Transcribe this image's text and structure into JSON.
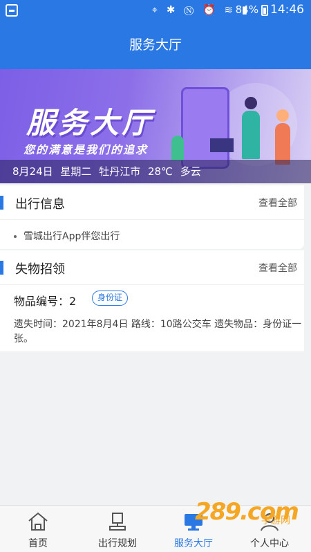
{
  "status_bar": {
    "icons": [
      "location-icon",
      "bluetooth-icon",
      "nfc-icon",
      "alarm-icon",
      "wifi-icon",
      "signal-icon"
    ],
    "battery": "84%",
    "time": "14:46"
  },
  "header": {
    "title": "服务大厅"
  },
  "banner": {
    "headline": "服务大厅",
    "slogan": "您的满意是我们的追求",
    "date": "8月24日",
    "weekday": "星期二",
    "city": "牡丹江市",
    "temperature": "28℃",
    "weather": "多云"
  },
  "travel_info": {
    "title": "出行信息",
    "more_label": "查看全部",
    "items": [
      "雪城出行App伴您出行"
    ]
  },
  "lost_found": {
    "title": "失物招领",
    "more_label": "查看全部",
    "item_no": "物品编号：2",
    "tag": "身份证",
    "description": "遗失时间：2021年8月4日 路线：10路公交车 遗失物品：身份证一张。"
  },
  "tabs": [
    {
      "label": "首页",
      "icon": "home-icon"
    },
    {
      "label": "出行规划",
      "icon": "bus-stop-icon"
    },
    {
      "label": "服务大厅",
      "icon": "monitor-icon",
      "active": true
    },
    {
      "label": "个人中心",
      "icon": "user-icon"
    }
  ],
  "watermark": {
    "brand": "289",
    "suffix": ".com",
    "sub": "手游网"
  },
  "colors": {
    "primary": "#2a78e4",
    "banner_start": "#7c5fe6",
    "watermark": "#f5a623"
  }
}
